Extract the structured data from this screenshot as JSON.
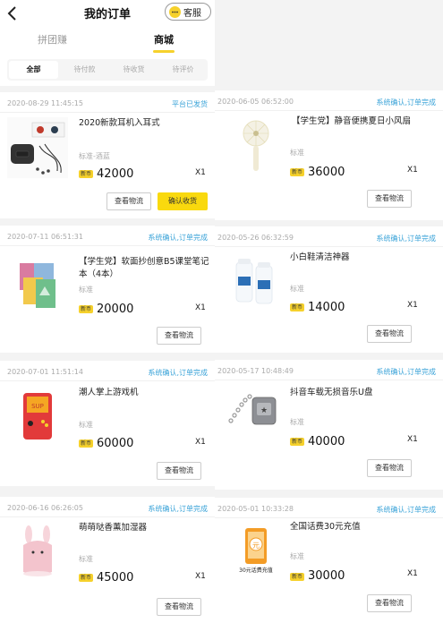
{
  "header": {
    "title": "我的订单",
    "kefu_label": "客服"
  },
  "top_tabs": [
    "拼团赚",
    "商城"
  ],
  "sub_tabs": [
    "全部",
    "待付款",
    "待收货",
    "待评价"
  ],
  "coin_label": "新币",
  "spec_label": "标准",
  "qty_label": "X1",
  "btn_logistics": "查看物流",
  "btn_confirm": "确认收货",
  "colors": {
    "accent": "#f6d12c",
    "status": "#3aa3d8"
  },
  "left_orders": [
    {
      "time": "2020-08-29 11:45:15",
      "status": "平台已发货",
      "name": "2020新款耳机入耳式",
      "spec": "标准-酒蓝",
      "price": "42000",
      "icon": "earphones-image"
    },
    {
      "time": "2020-07-11 06:51:31",
      "status": "系统确认,订单完成",
      "name": "【学生党】软面抄创意B5课堂笔记本（4本）",
      "spec": "标准",
      "price": "20000",
      "icon": "notebook-image"
    },
    {
      "time": "2020-07-01 11:51:14",
      "status": "系统确认,订单完成",
      "name": "潮人掌上游戏机",
      "spec": "标准",
      "price": "60000",
      "icon": "game-console-image"
    },
    {
      "time": "2020-06-16 06:26:05",
      "status": "系统确认,订单完成",
      "name": "萌萌哒香薰加湿器",
      "spec": "标准",
      "price": "45000",
      "icon": "humidifier-image"
    }
  ],
  "right_orders": [
    {
      "time": "2020-06-05 06:52:00",
      "status": "系统确认,订单完成",
      "name": "【学生党】静音便携夏日小风扇",
      "spec": "标准",
      "price": "36000",
      "icon": "fan-image"
    },
    {
      "time": "2020-05-26 06:32:59",
      "status": "系统确认,订单完成",
      "name": "小白鞋清洁神器",
      "spec": "标准",
      "price": "14000",
      "icon": "shoe-cleaner-image"
    },
    {
      "time": "2020-05-17 10:48:49",
      "status": "系统确认,订单完成",
      "name": "抖音车载无损音乐U盘",
      "spec": "标准",
      "price": "40000",
      "icon": "usb-drive-image"
    },
    {
      "time": "2020-05-01 10:33:28",
      "status": "系统确认,订单完成",
      "name": "全国话费30元充值",
      "spec": "标准",
      "price": "30000",
      "icon": "phone-recharge-image",
      "image_caption": "30元话费充值"
    }
  ]
}
